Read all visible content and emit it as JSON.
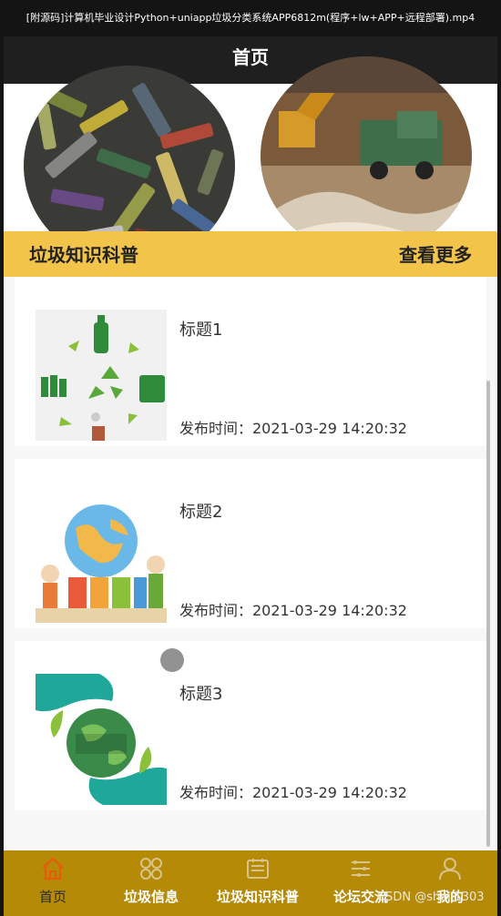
{
  "video": {
    "title": "[附源码]计算机毕业设计Python+uniapp垃圾分类系统APP6812m(程序+lw+APP+远程部署).mp4"
  },
  "nav": {
    "title": "首页"
  },
  "section": {
    "title": "垃圾知识科普",
    "more": "查看更多"
  },
  "articles": [
    {
      "title": "标题1",
      "time": "发布时间：2021-03-29 14:20:32"
    },
    {
      "title": "标题2",
      "time": "发布时间：2021-03-29 14:20:32"
    },
    {
      "title": "标题3",
      "time": "发布时间：2021-03-29 14:20:32"
    }
  ],
  "tabbar": {
    "items": [
      {
        "label": "首页",
        "icon": "home-icon",
        "active": true
      },
      {
        "label": "垃圾信息",
        "icon": "grid-icon"
      },
      {
        "label": "垃圾知识科普",
        "icon": "book-icon"
      },
      {
        "label": "论坛交流",
        "icon": "list-icon"
      },
      {
        "label": "我的",
        "icon": "user-icon"
      }
    ]
  },
  "watermark": "CSDN @sheji1303",
  "colors": {
    "accent": "#f2c44a",
    "tabbar": "#b58a07",
    "navbar": "#1f1f1f",
    "active_icon": "#e85b0c"
  }
}
